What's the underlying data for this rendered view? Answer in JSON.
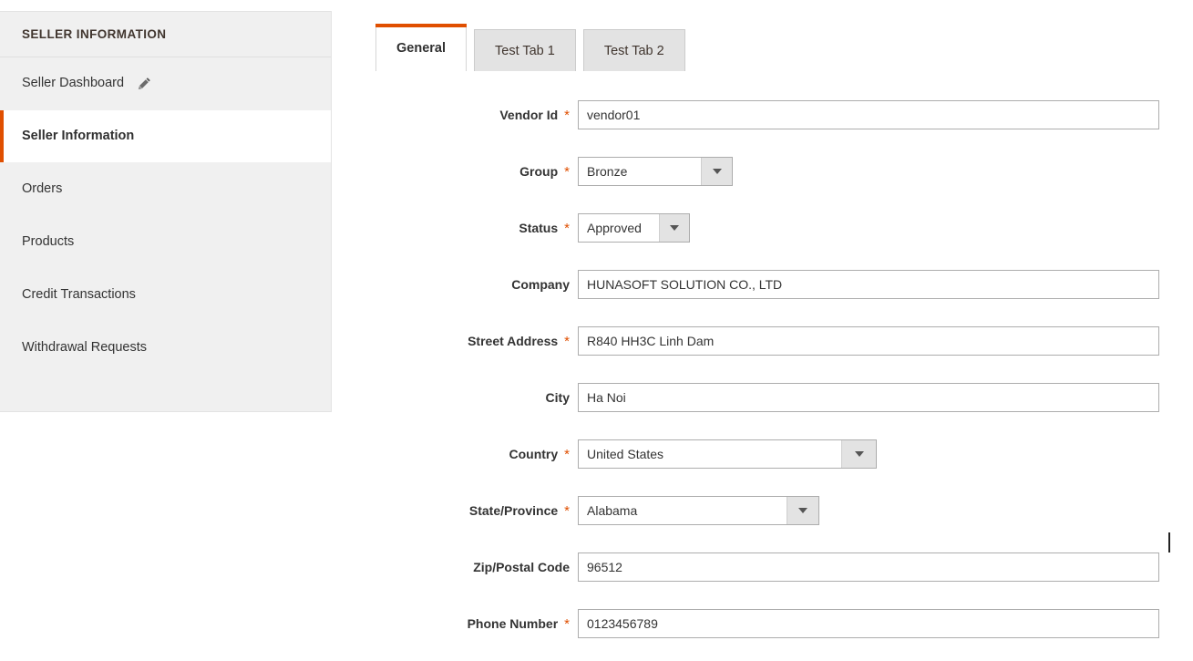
{
  "sidebar": {
    "header": "SELLER INFORMATION",
    "items": [
      {
        "label": "Seller Dashboard",
        "icon": "pencil-icon",
        "active": false,
        "has_icon": true
      },
      {
        "label": "Seller Information",
        "active": true,
        "has_icon": false
      },
      {
        "label": "Orders",
        "active": false,
        "has_icon": false
      },
      {
        "label": "Products",
        "active": false,
        "has_icon": false
      },
      {
        "label": "Credit Transactions",
        "active": false,
        "has_icon": false
      },
      {
        "label": "Withdrawal Requests",
        "active": false,
        "has_icon": false
      }
    ]
  },
  "tabs": [
    {
      "label": "General",
      "active": true
    },
    {
      "label": "Test Tab 1",
      "active": false
    },
    {
      "label": "Test Tab 2",
      "active": false
    }
  ],
  "form": {
    "required_marker": "*",
    "fields": [
      {
        "label": "Vendor Id",
        "required": true,
        "type": "text",
        "value": "vendor01"
      },
      {
        "label": "Group",
        "required": true,
        "type": "select",
        "value": "Bronze"
      },
      {
        "label": "Status",
        "required": true,
        "type": "select",
        "value": "Approved"
      },
      {
        "label": "Company",
        "required": false,
        "type": "text",
        "value": "HUNASOFT SOLUTION CO., LTD"
      },
      {
        "label": "Street Address",
        "required": true,
        "type": "text",
        "value": "R840 HH3C Linh Dam"
      },
      {
        "label": "City",
        "required": false,
        "type": "text",
        "value": "Ha Noi"
      },
      {
        "label": "Country",
        "required": true,
        "type": "select",
        "value": "United States"
      },
      {
        "label": "State/Province",
        "required": true,
        "type": "select",
        "value": "Alabama"
      },
      {
        "label": "Zip/Postal Code",
        "required": false,
        "type": "text",
        "value": "96512"
      },
      {
        "label": "Phone Number",
        "required": true,
        "type": "text",
        "value": "0123456789"
      }
    ]
  },
  "colors": {
    "accent": "#e04f00",
    "sidebar_bg": "#f0f0f0",
    "tab_inactive_bg": "#e3e3e3",
    "label_text": "#333333",
    "input_border": "#adadad"
  }
}
